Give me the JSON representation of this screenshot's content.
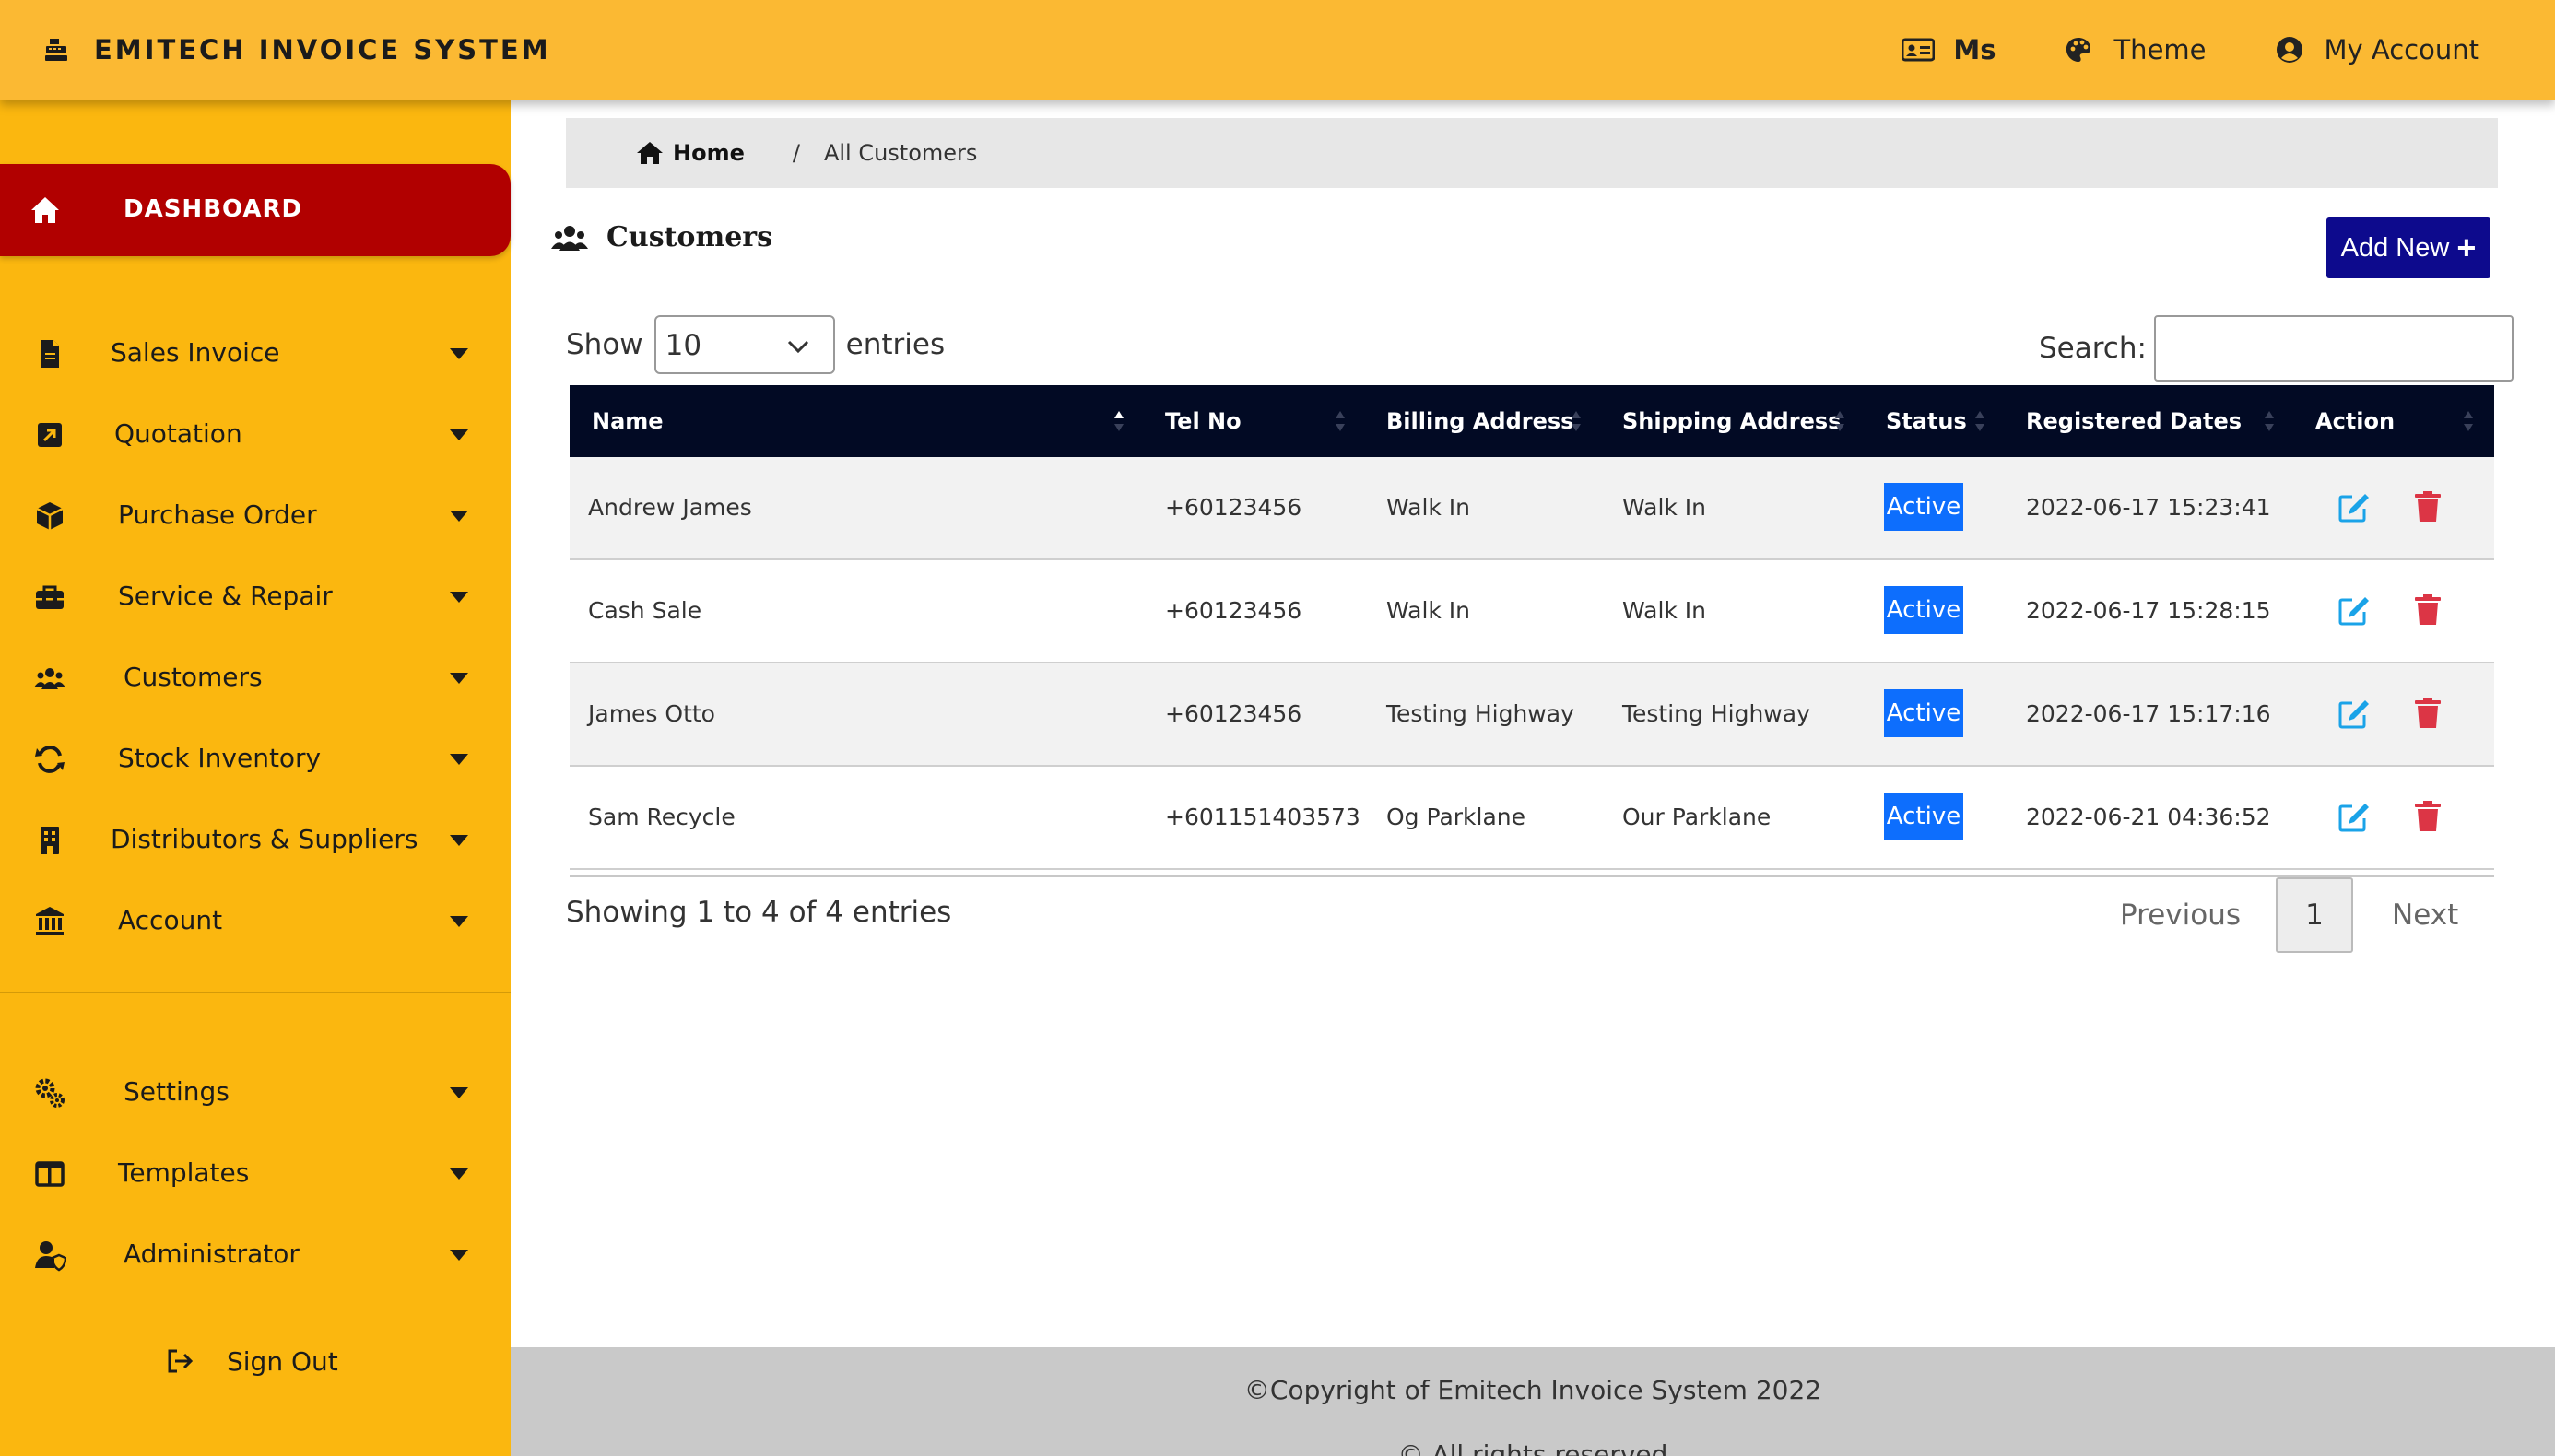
{
  "app": {
    "title": "EMITECH INVOICE SYSTEM",
    "brand_color": "#fbb933"
  },
  "topnav": {
    "user_label": "Ms",
    "theme_label": "Theme",
    "account_label": "My Account"
  },
  "sidebar": {
    "dashboard_label": "DASHBOARD",
    "items": [
      {
        "label": "Sales Invoice",
        "icon": "file-icon"
      },
      {
        "label": "Quotation",
        "icon": "quote-square-icon"
      },
      {
        "label": "Purchase Order",
        "icon": "box-icon"
      },
      {
        "label": "Service & Repair",
        "icon": "toolbox-icon"
      },
      {
        "label": "Customers",
        "icon": "users-icon"
      },
      {
        "label": "Stock Inventory",
        "icon": "sync-icon"
      },
      {
        "label": "Distributors & Suppliers",
        "icon": "building-icon"
      },
      {
        "label": "Account",
        "icon": "bank-icon"
      },
      {
        "label": "Settings",
        "icon": "cogs-icon"
      },
      {
        "label": "Templates",
        "icon": "layout-icon"
      },
      {
        "label": "Administrator",
        "icon": "user-shield-icon"
      }
    ],
    "signout_label": "Sign Out"
  },
  "breadcrumb": {
    "home": "Home",
    "separator": "/",
    "current": "All Customers"
  },
  "page": {
    "title": "Customers",
    "add_button": "Add New"
  },
  "table_controls": {
    "show_label": "Show",
    "page_length": "10",
    "entries_label": "entries",
    "search_label": "Search:",
    "search_value": ""
  },
  "table": {
    "columns": [
      "Name",
      "Tel No",
      "Billing Address",
      "Shipping Address",
      "Status",
      "Registered Dates",
      "Action"
    ],
    "rows": [
      {
        "name": "Andrew James",
        "tel": "+60123456",
        "billing": "Walk In",
        "shipping": "Walk In",
        "status": "Active",
        "registered": "2022-06-17 15:23:41"
      },
      {
        "name": "Cash Sale",
        "tel": "+60123456",
        "billing": "Walk In",
        "shipping": "Walk In",
        "status": "Active",
        "registered": "2022-06-17 15:28:15"
      },
      {
        "name": "James Otto",
        "tel": "+60123456",
        "billing": "Testing Highway",
        "shipping": "Testing Highway",
        "status": "Active",
        "registered": "2022-06-17 15:17:16"
      },
      {
        "name": "Sam Recycle",
        "tel": "+601151403573",
        "billing": "Og Parklane",
        "shipping": "Our Parklane",
        "status": "Active",
        "registered": "2022-06-21 04:36:52"
      }
    ],
    "status_color": "#0d6efd",
    "edit_color": "#1aa3e8",
    "delete_color": "#dc3545"
  },
  "pagination": {
    "info": "Showing 1 to 4 of 4 entries",
    "previous": "Previous",
    "current_page": "1",
    "next": "Next"
  },
  "footer": {
    "copyright": "©Copyright of Emitech Invoice System 2022",
    "rights": "© All rights reserved"
  }
}
